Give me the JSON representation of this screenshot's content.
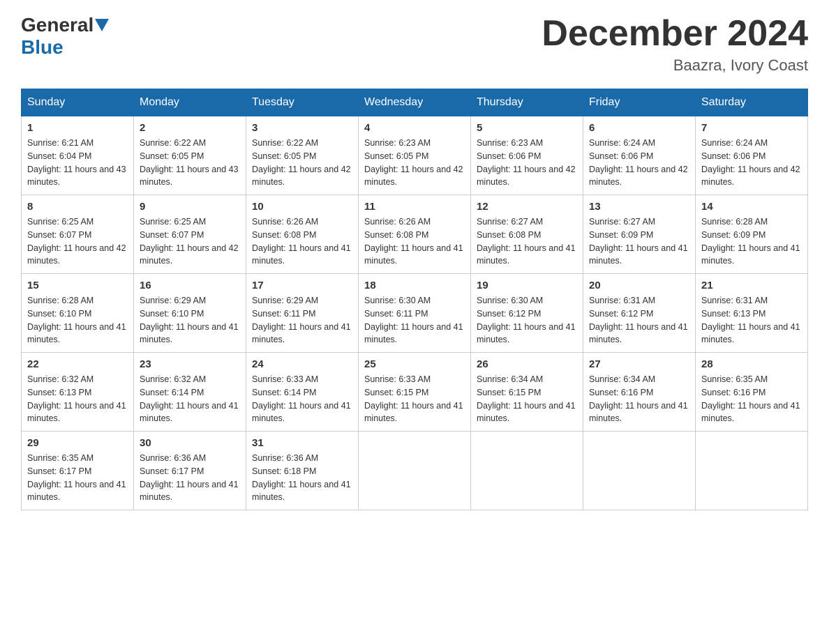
{
  "header": {
    "logo": {
      "general": "General",
      "blue": "Blue"
    },
    "title": "December 2024",
    "location": "Baazra, Ivory Coast"
  },
  "weekdays": [
    "Sunday",
    "Monday",
    "Tuesday",
    "Wednesday",
    "Thursday",
    "Friday",
    "Saturday"
  ],
  "weeks": [
    [
      {
        "day": "1",
        "sunrise": "6:21 AM",
        "sunset": "6:04 PM",
        "daylight": "11 hours and 43 minutes."
      },
      {
        "day": "2",
        "sunrise": "6:22 AM",
        "sunset": "6:05 PM",
        "daylight": "11 hours and 43 minutes."
      },
      {
        "day": "3",
        "sunrise": "6:22 AM",
        "sunset": "6:05 PM",
        "daylight": "11 hours and 42 minutes."
      },
      {
        "day": "4",
        "sunrise": "6:23 AM",
        "sunset": "6:05 PM",
        "daylight": "11 hours and 42 minutes."
      },
      {
        "day": "5",
        "sunrise": "6:23 AM",
        "sunset": "6:06 PM",
        "daylight": "11 hours and 42 minutes."
      },
      {
        "day": "6",
        "sunrise": "6:24 AM",
        "sunset": "6:06 PM",
        "daylight": "11 hours and 42 minutes."
      },
      {
        "day": "7",
        "sunrise": "6:24 AM",
        "sunset": "6:06 PM",
        "daylight": "11 hours and 42 minutes."
      }
    ],
    [
      {
        "day": "8",
        "sunrise": "6:25 AM",
        "sunset": "6:07 PM",
        "daylight": "11 hours and 42 minutes."
      },
      {
        "day": "9",
        "sunrise": "6:25 AM",
        "sunset": "6:07 PM",
        "daylight": "11 hours and 42 minutes."
      },
      {
        "day": "10",
        "sunrise": "6:26 AM",
        "sunset": "6:08 PM",
        "daylight": "11 hours and 41 minutes."
      },
      {
        "day": "11",
        "sunrise": "6:26 AM",
        "sunset": "6:08 PM",
        "daylight": "11 hours and 41 minutes."
      },
      {
        "day": "12",
        "sunrise": "6:27 AM",
        "sunset": "6:08 PM",
        "daylight": "11 hours and 41 minutes."
      },
      {
        "day": "13",
        "sunrise": "6:27 AM",
        "sunset": "6:09 PM",
        "daylight": "11 hours and 41 minutes."
      },
      {
        "day": "14",
        "sunrise": "6:28 AM",
        "sunset": "6:09 PM",
        "daylight": "11 hours and 41 minutes."
      }
    ],
    [
      {
        "day": "15",
        "sunrise": "6:28 AM",
        "sunset": "6:10 PM",
        "daylight": "11 hours and 41 minutes."
      },
      {
        "day": "16",
        "sunrise": "6:29 AM",
        "sunset": "6:10 PM",
        "daylight": "11 hours and 41 minutes."
      },
      {
        "day": "17",
        "sunrise": "6:29 AM",
        "sunset": "6:11 PM",
        "daylight": "11 hours and 41 minutes."
      },
      {
        "day": "18",
        "sunrise": "6:30 AM",
        "sunset": "6:11 PM",
        "daylight": "11 hours and 41 minutes."
      },
      {
        "day": "19",
        "sunrise": "6:30 AM",
        "sunset": "6:12 PM",
        "daylight": "11 hours and 41 minutes."
      },
      {
        "day": "20",
        "sunrise": "6:31 AM",
        "sunset": "6:12 PM",
        "daylight": "11 hours and 41 minutes."
      },
      {
        "day": "21",
        "sunrise": "6:31 AM",
        "sunset": "6:13 PM",
        "daylight": "11 hours and 41 minutes."
      }
    ],
    [
      {
        "day": "22",
        "sunrise": "6:32 AM",
        "sunset": "6:13 PM",
        "daylight": "11 hours and 41 minutes."
      },
      {
        "day": "23",
        "sunrise": "6:32 AM",
        "sunset": "6:14 PM",
        "daylight": "11 hours and 41 minutes."
      },
      {
        "day": "24",
        "sunrise": "6:33 AM",
        "sunset": "6:14 PM",
        "daylight": "11 hours and 41 minutes."
      },
      {
        "day": "25",
        "sunrise": "6:33 AM",
        "sunset": "6:15 PM",
        "daylight": "11 hours and 41 minutes."
      },
      {
        "day": "26",
        "sunrise": "6:34 AM",
        "sunset": "6:15 PM",
        "daylight": "11 hours and 41 minutes."
      },
      {
        "day": "27",
        "sunrise": "6:34 AM",
        "sunset": "6:16 PM",
        "daylight": "11 hours and 41 minutes."
      },
      {
        "day": "28",
        "sunrise": "6:35 AM",
        "sunset": "6:16 PM",
        "daylight": "11 hours and 41 minutes."
      }
    ],
    [
      {
        "day": "29",
        "sunrise": "6:35 AM",
        "sunset": "6:17 PM",
        "daylight": "11 hours and 41 minutes."
      },
      {
        "day": "30",
        "sunrise": "6:36 AM",
        "sunset": "6:17 PM",
        "daylight": "11 hours and 41 minutes."
      },
      {
        "day": "31",
        "sunrise": "6:36 AM",
        "sunset": "6:18 PM",
        "daylight": "11 hours and 41 minutes."
      },
      null,
      null,
      null,
      null
    ]
  ]
}
